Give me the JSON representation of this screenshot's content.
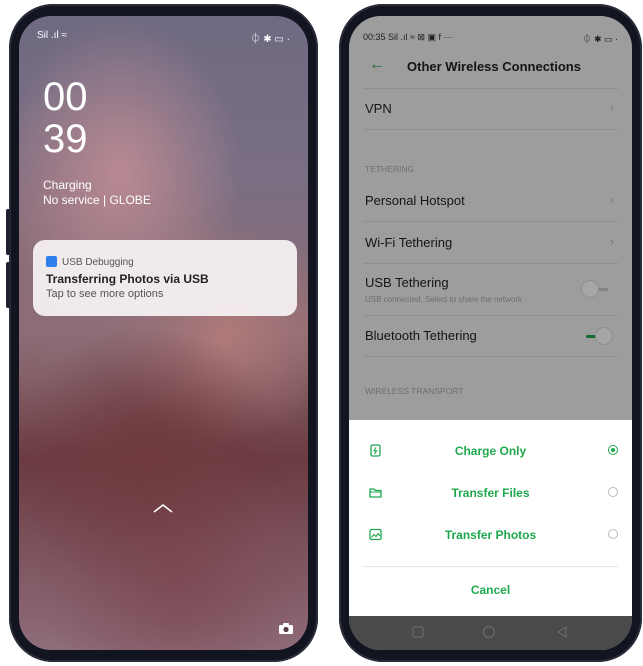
{
  "lock_screen": {
    "status_left": "Sil .ıl ≈",
    "status_right": "⏀ ✱ ▭ ·",
    "clock_hours": "00",
    "clock_minutes": "39",
    "charging_text": "Charging",
    "network_text": "No service | GLOBE",
    "notification": {
      "app_name": "USB Debugging",
      "title": "Transferring Photos via USB",
      "subtitle": "Tap to see more options"
    }
  },
  "settings_screen": {
    "status_time": "00:35",
    "status_left_icons": "Sil .ıl ≈ ⊠ ▣ f ···",
    "status_right": "⏀ ✱ ▭ ·",
    "title": "Other Wireless Connections",
    "rows": {
      "vpn": "VPN",
      "tethering_header": "TETHERING",
      "personal_hotspot": "Personal Hotspot",
      "wifi_tethering": "Wi-Fi Tethering",
      "usb_tethering": "USB Tethering",
      "usb_tethering_sub": "USB connected. Select to share the network",
      "bluetooth_tethering": "Bluetooth Tethering",
      "wireless_transport_header": "WIRELESS TRANSPORT"
    },
    "toggles": {
      "usb_tethering": false,
      "bluetooth_tethering": true
    },
    "usb_options": [
      {
        "label": "Charge Only",
        "selected": true,
        "icon": "battery-charge-icon"
      },
      {
        "label": "Transfer Files",
        "selected": false,
        "icon": "folder-icon"
      },
      {
        "label": "Transfer Photos",
        "selected": false,
        "icon": "photo-icon"
      }
    ],
    "cancel_label": "Cancel"
  },
  "colors": {
    "accent": "#1fa84d",
    "notification_icon": "#2f80ed"
  }
}
